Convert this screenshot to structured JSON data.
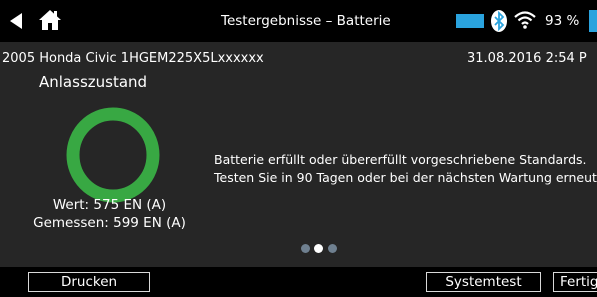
{
  "header": {
    "title": "Testergebnisse – Batterie",
    "battery_percent": "93 %",
    "icons": [
      "back-arrow-icon",
      "home-icon",
      "battery-icon",
      "bluetooth-icon",
      "wifi-icon"
    ]
  },
  "vehicle": {
    "info": "2005 Honda Civic 1HGEM225X5Lxxxxxx",
    "datetime": "31.08.2016  2:54 P"
  },
  "result": {
    "heading": "Anlasszustand",
    "status_color": "#38a843",
    "message_line1": "Batterie erfüllt oder übererfüllt vorgeschriebene Standards.",
    "message_line2": "Testen Sie in 90 Tagen oder bei der nächsten Wartung erneut",
    "rated": "Wert: 575 EN (A)",
    "measured": "Gemessen: 599 EN (A)"
  },
  "pager": {
    "pages": 3,
    "active": 2
  },
  "footer": {
    "print_label": "Drucken",
    "system_test_label": "Systemtest",
    "done_label": "Fertig"
  },
  "colors": {
    "accent_blue": "#2aa3de",
    "panel_bg": "#262626",
    "bar_bg": "#000000"
  }
}
